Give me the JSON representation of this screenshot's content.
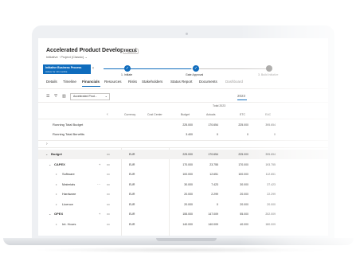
{
  "header": {
    "title": "Accelerated Product Development",
    "saved": "- Saved",
    "subtitle": "Initiative · Project (Classic) ⌄"
  },
  "bpf": {
    "title": "Initiative Business Process",
    "sub": "Active for 10 months",
    "chevron": "‹"
  },
  "stages": [
    {
      "label": "1. Initiate"
    },
    {
      "label": "Gate Approval"
    },
    {
      "label": "3. Build Initiative"
    }
  ],
  "tabs": [
    "Details",
    "Timeline",
    "Financials",
    "Resources",
    "Risks",
    "Stakeholders",
    "Status Report",
    "Documents",
    "Dashboard"
  ],
  "toolbar": {
    "icons": [
      "list-icon",
      "filter-icon",
      "table-icon"
    ],
    "dropdown": "Accelerated Prod...",
    "year": "2023"
  },
  "grid_header": {
    "total_label": "Total 2023",
    "currency": "Currency",
    "cost_center": "Cost Center",
    "budget": "Budget",
    "actuals": "Actuals",
    "etc": "ETC",
    "eac": "EAC",
    "collapse": "‹"
  },
  "running": [
    {
      "label": "Running Total Budget",
      "budget": "225.000",
      "actuals": "170.654",
      "etc": "225.000",
      "eac": "395.654"
    },
    {
      "label": "Running Total Benefits",
      "budget": "3.400",
      "actuals": "0",
      "etc": "0",
      "eac": "0"
    }
  ],
  "expander": "›",
  "rows": [
    {
      "label": "Budget",
      "currency": "EUR",
      "budget": "225.000",
      "actuals": "170.654",
      "etc": "225.000",
      "eac": "395.654",
      "level": 0,
      "arrow": "⌄"
    },
    {
      "label": "CAPEX",
      "currency": "EUR",
      "budget": "170.000",
      "actuals": "23.755",
      "etc": "170.000",
      "eac": "193.755",
      "level": 1,
      "arrow": "⌄",
      "plus": "+"
    },
    {
      "label": "Software",
      "currency": "EUR",
      "budget": "100.000",
      "actuals": "12.651",
      "etc": "100.000",
      "eac": "112.651",
      "level": 2,
      "dot": "•"
    },
    {
      "label": "Materials",
      "currency": "EUR",
      "budget": "30.000",
      "actuals": "7.423",
      "etc": "30.000",
      "eac": "37.423",
      "level": 2,
      "dot": "•",
      "more": "···"
    },
    {
      "label": "Hardware",
      "currency": "EUR",
      "budget": "20.000",
      "actuals": "2.299",
      "etc": "20.000",
      "eac": "22.299",
      "level": 2,
      "dot": "•"
    },
    {
      "label": "Licence",
      "currency": "EUR",
      "budget": "20.000",
      "actuals": "0",
      "etc": "20.000",
      "eac": "20.000",
      "level": 2,
      "dot": "•"
    },
    {
      "label": "OPEX",
      "currency": "EUR",
      "budget": "155.000",
      "actuals": "147.009",
      "etc": "55.000",
      "eac": "202.009",
      "level": 1,
      "arrow": "⌄",
      "plus": "+"
    },
    {
      "label": "Int. Hours",
      "currency": "EUR",
      "budget": "140.000",
      "actuals": "140.009",
      "etc": "40.000",
      "eac": "180.009",
      "level": 2,
      "dot": "•"
    }
  ],
  "colors": {
    "accent": "#0f6cbd",
    "stage_done": "#0f6cbd",
    "stage_future": "#8a8886"
  }
}
